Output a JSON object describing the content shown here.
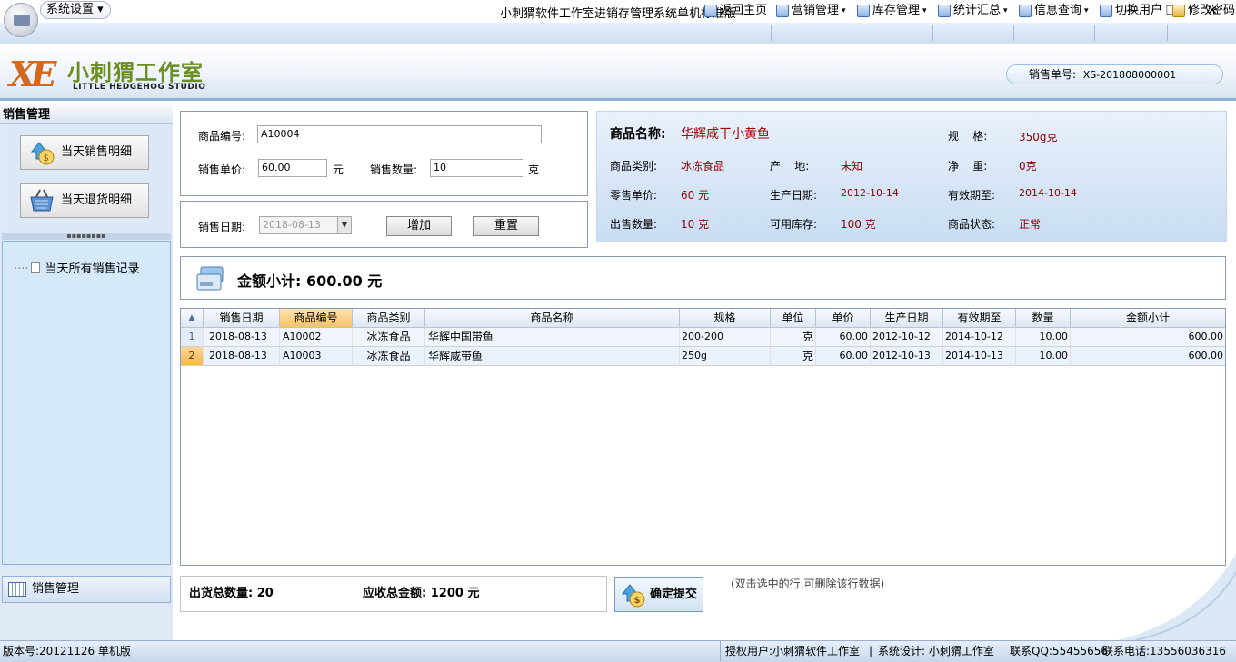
{
  "window": {
    "title": "小刺猬软件工作室进销存管理系统单机标准版",
    "sys_menu": "系统设置"
  },
  "menubar": [
    {
      "label": "返回主页"
    },
    {
      "label": "营销管理"
    },
    {
      "label": "库存管理"
    },
    {
      "label": "统计汇总"
    },
    {
      "label": "信息查询"
    },
    {
      "label": "切换用户"
    },
    {
      "label": "修改密码"
    }
  ],
  "logo": {
    "cn": "小刺猬工作室",
    "en": "LITTLE HEDGEHOG STUDIO",
    "mark": "XE"
  },
  "order": {
    "label": "销售单号:",
    "value": "XS-201808000001"
  },
  "sidebar": {
    "title": "销售管理",
    "buttons": [
      {
        "label": "当天销售明细"
      },
      {
        "label": "当天退货明细"
      }
    ],
    "splitter": "▪▪▪▪▪▪▪▪",
    "tree_item": "当天所有销售记录",
    "bottom_label": "销售管理"
  },
  "form": {
    "code_label": "商品编号:",
    "code_value": "A10004",
    "price_label": "销售单价:",
    "price_value": "60.00",
    "price_unit": "元",
    "qty_label": "销售数量:",
    "qty_value": "10",
    "qty_unit": "克",
    "date_label": "销售日期:",
    "date_value": "2018-08-13",
    "add_label": "增加",
    "reset_label": "重置"
  },
  "info": {
    "name_label": "商品名称:",
    "name_value": "华辉咸干小黄鱼",
    "spec_label": "规    格:",
    "spec_value": "350g克",
    "category_label": "商品类别:",
    "category_value": "冰冻食品",
    "origin_label": "产    地:",
    "origin_value": "未知",
    "weight_label": "净    重:",
    "weight_value": "0克",
    "retail_label": "零售单价:",
    "retail_value": "60 元",
    "mfg_label": "生产日期:",
    "mfg_value": "2012-10-14",
    "exp_label": "有效期至:",
    "exp_value": "2014-10-14",
    "outqty_label": "出售数量:",
    "outqty_value": "10 克",
    "stock_label": "可用库存:",
    "stock_value": "100 克",
    "status_label": "商品状态:",
    "status_value": "正常"
  },
  "subtotal": {
    "label": "金额小计:",
    "value": "600.00 元"
  },
  "grid": {
    "columns": [
      "销售日期",
      "商品编号",
      "商品类别",
      "商品名称",
      "规格",
      "单位",
      "单价",
      "生产日期",
      "有效期至",
      "数量",
      "金额小计"
    ],
    "rows": [
      {
        "num": "1",
        "date": "2018-08-13",
        "code": "A10002",
        "category": "冰冻食品",
        "name": "华辉中国带鱼",
        "spec": "200-200",
        "unit": "克",
        "price": "60.00",
        "mfg": "2012-10-12",
        "exp": "2014-10-12",
        "qty": "10.00",
        "amount": "600.00"
      },
      {
        "num": "2",
        "date": "2018-08-13",
        "code": "A10003",
        "category": "冰冻食品",
        "name": "华辉咸带鱼",
        "spec": "250g",
        "unit": "克",
        "price": "60.00",
        "mfg": "2012-10-13",
        "exp": "2014-10-13",
        "qty": "10.00",
        "amount": "600.00"
      }
    ]
  },
  "totals": {
    "qty_label": "出货总数量:",
    "qty_value": "20",
    "amount_label": "应收总金额:",
    "amount_value": "1200",
    "amount_unit": "元"
  },
  "submit_label": "确定提交",
  "hint": "(双击选中的行,可删除该行数据)",
  "status": {
    "version": "版本号:20121126 单机版",
    "licensed": "授权用户:小刺猬软件工作室",
    "designer": "系统设计: 小刺猬工作室",
    "qq": "联系QQ:55455656",
    "phone": "联系电话:13556036316"
  }
}
